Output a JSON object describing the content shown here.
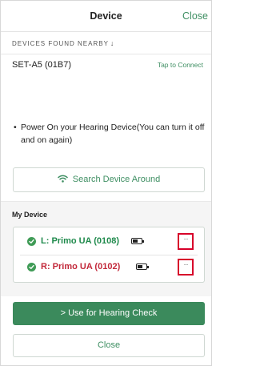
{
  "header": {
    "title": "Device",
    "close_label": "Close"
  },
  "nearby": {
    "label": "DEVICES FOUND NEARBY",
    "arrow_icon": "↓",
    "devices": [
      {
        "name": "SET-A5 (01B7)",
        "action": "Tap to Connect"
      }
    ]
  },
  "instruction": {
    "bullet": "•",
    "text": "Power On your Hearing Device(You can turn it off and on again)"
  },
  "search_button": {
    "label": "Search Device Around",
    "icon": "wifi-icon"
  },
  "my_device": {
    "title": "My Device",
    "devices": [
      {
        "side": "left",
        "name": "L: Primo UA (0108)",
        "status_icon": "check-icon",
        "more_label": "···",
        "color": "#1f8a4c"
      },
      {
        "side": "right",
        "name": "R: Primo UA (0102)",
        "status_icon": "check-icon",
        "more_label": "···",
        "color": "#c2283a"
      }
    ]
  },
  "footer": {
    "hearing_check_label": "> Use for Hearing Check",
    "close_label": "Close"
  },
  "colors": {
    "accent": "#3f8f63",
    "primary_button": "#3b8a5c",
    "highlight_box": "#d7002a"
  }
}
